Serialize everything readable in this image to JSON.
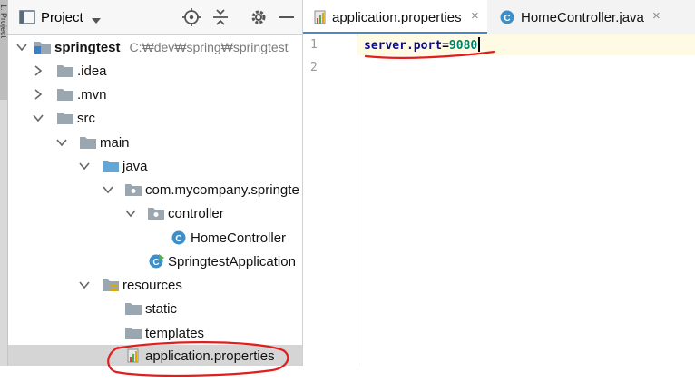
{
  "toolstrip": {
    "label": "1: Project"
  },
  "panel": {
    "title": "Project"
  },
  "tree": [
    {
      "label": "springtest",
      "path": "C:₩dev₩spring₩springtest",
      "bold": true
    },
    {
      "label": ".idea"
    },
    {
      "label": ".mvn"
    },
    {
      "label": "src"
    },
    {
      "label": "main"
    },
    {
      "label": "java"
    },
    {
      "label": "com.mycompany.springte"
    },
    {
      "label": "controller"
    },
    {
      "label": "HomeController"
    },
    {
      "label": "SpringtestApplication"
    },
    {
      "label": "resources"
    },
    {
      "label": "static"
    },
    {
      "label": "templates"
    },
    {
      "label": "application.properties"
    }
  ],
  "tabs": [
    {
      "label": "application.properties",
      "close": "×",
      "active": true
    },
    {
      "label": "HomeController.java",
      "close": "×",
      "active": false
    }
  ],
  "gutter": {
    "lines": [
      "1",
      "2"
    ]
  },
  "code": {
    "key": "server.port",
    "sep": "=",
    "value": "9080"
  },
  "colors": {
    "folder": "#9aa7b0",
    "source_folder": "#63a7d6",
    "class_icon": "#3d8fc9",
    "annotation": "#e11d1d",
    "selection": "#d5d5d5",
    "active_tab_underline": "#4a88c7"
  }
}
